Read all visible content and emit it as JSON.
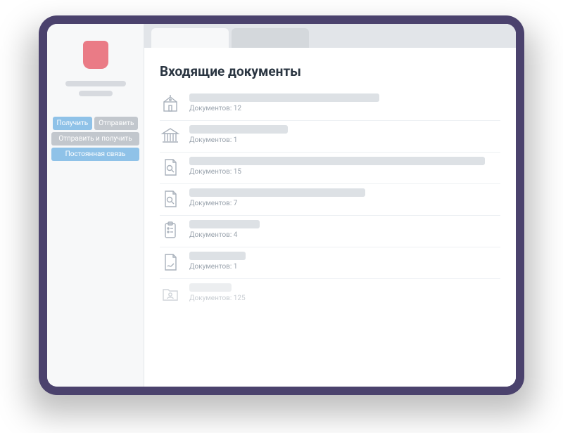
{
  "sidebar": {
    "buttons": {
      "receive": "Получить",
      "send": "Отправить",
      "send_receive": "Отправить и получить",
      "persistent": "Постоянная связь"
    }
  },
  "main": {
    "title": "Входящие документы",
    "count_label": "Документов:",
    "items": [
      {
        "icon": "building-gov",
        "count": 12,
        "ghost_w": 270
      },
      {
        "icon": "building-columns",
        "count": 1,
        "ghost_w": 140
      },
      {
        "icon": "doc-search",
        "count": 15,
        "ghost_w": 420
      },
      {
        "icon": "doc-search",
        "count": 7,
        "ghost_w": 250
      },
      {
        "icon": "doc-list",
        "count": 4,
        "ghost_w": 100
      },
      {
        "icon": "doc-sign",
        "count": 1,
        "ghost_w": 80
      },
      {
        "icon": "folder-user",
        "count": 125,
        "ghost_w": 60,
        "faded": true
      }
    ]
  }
}
